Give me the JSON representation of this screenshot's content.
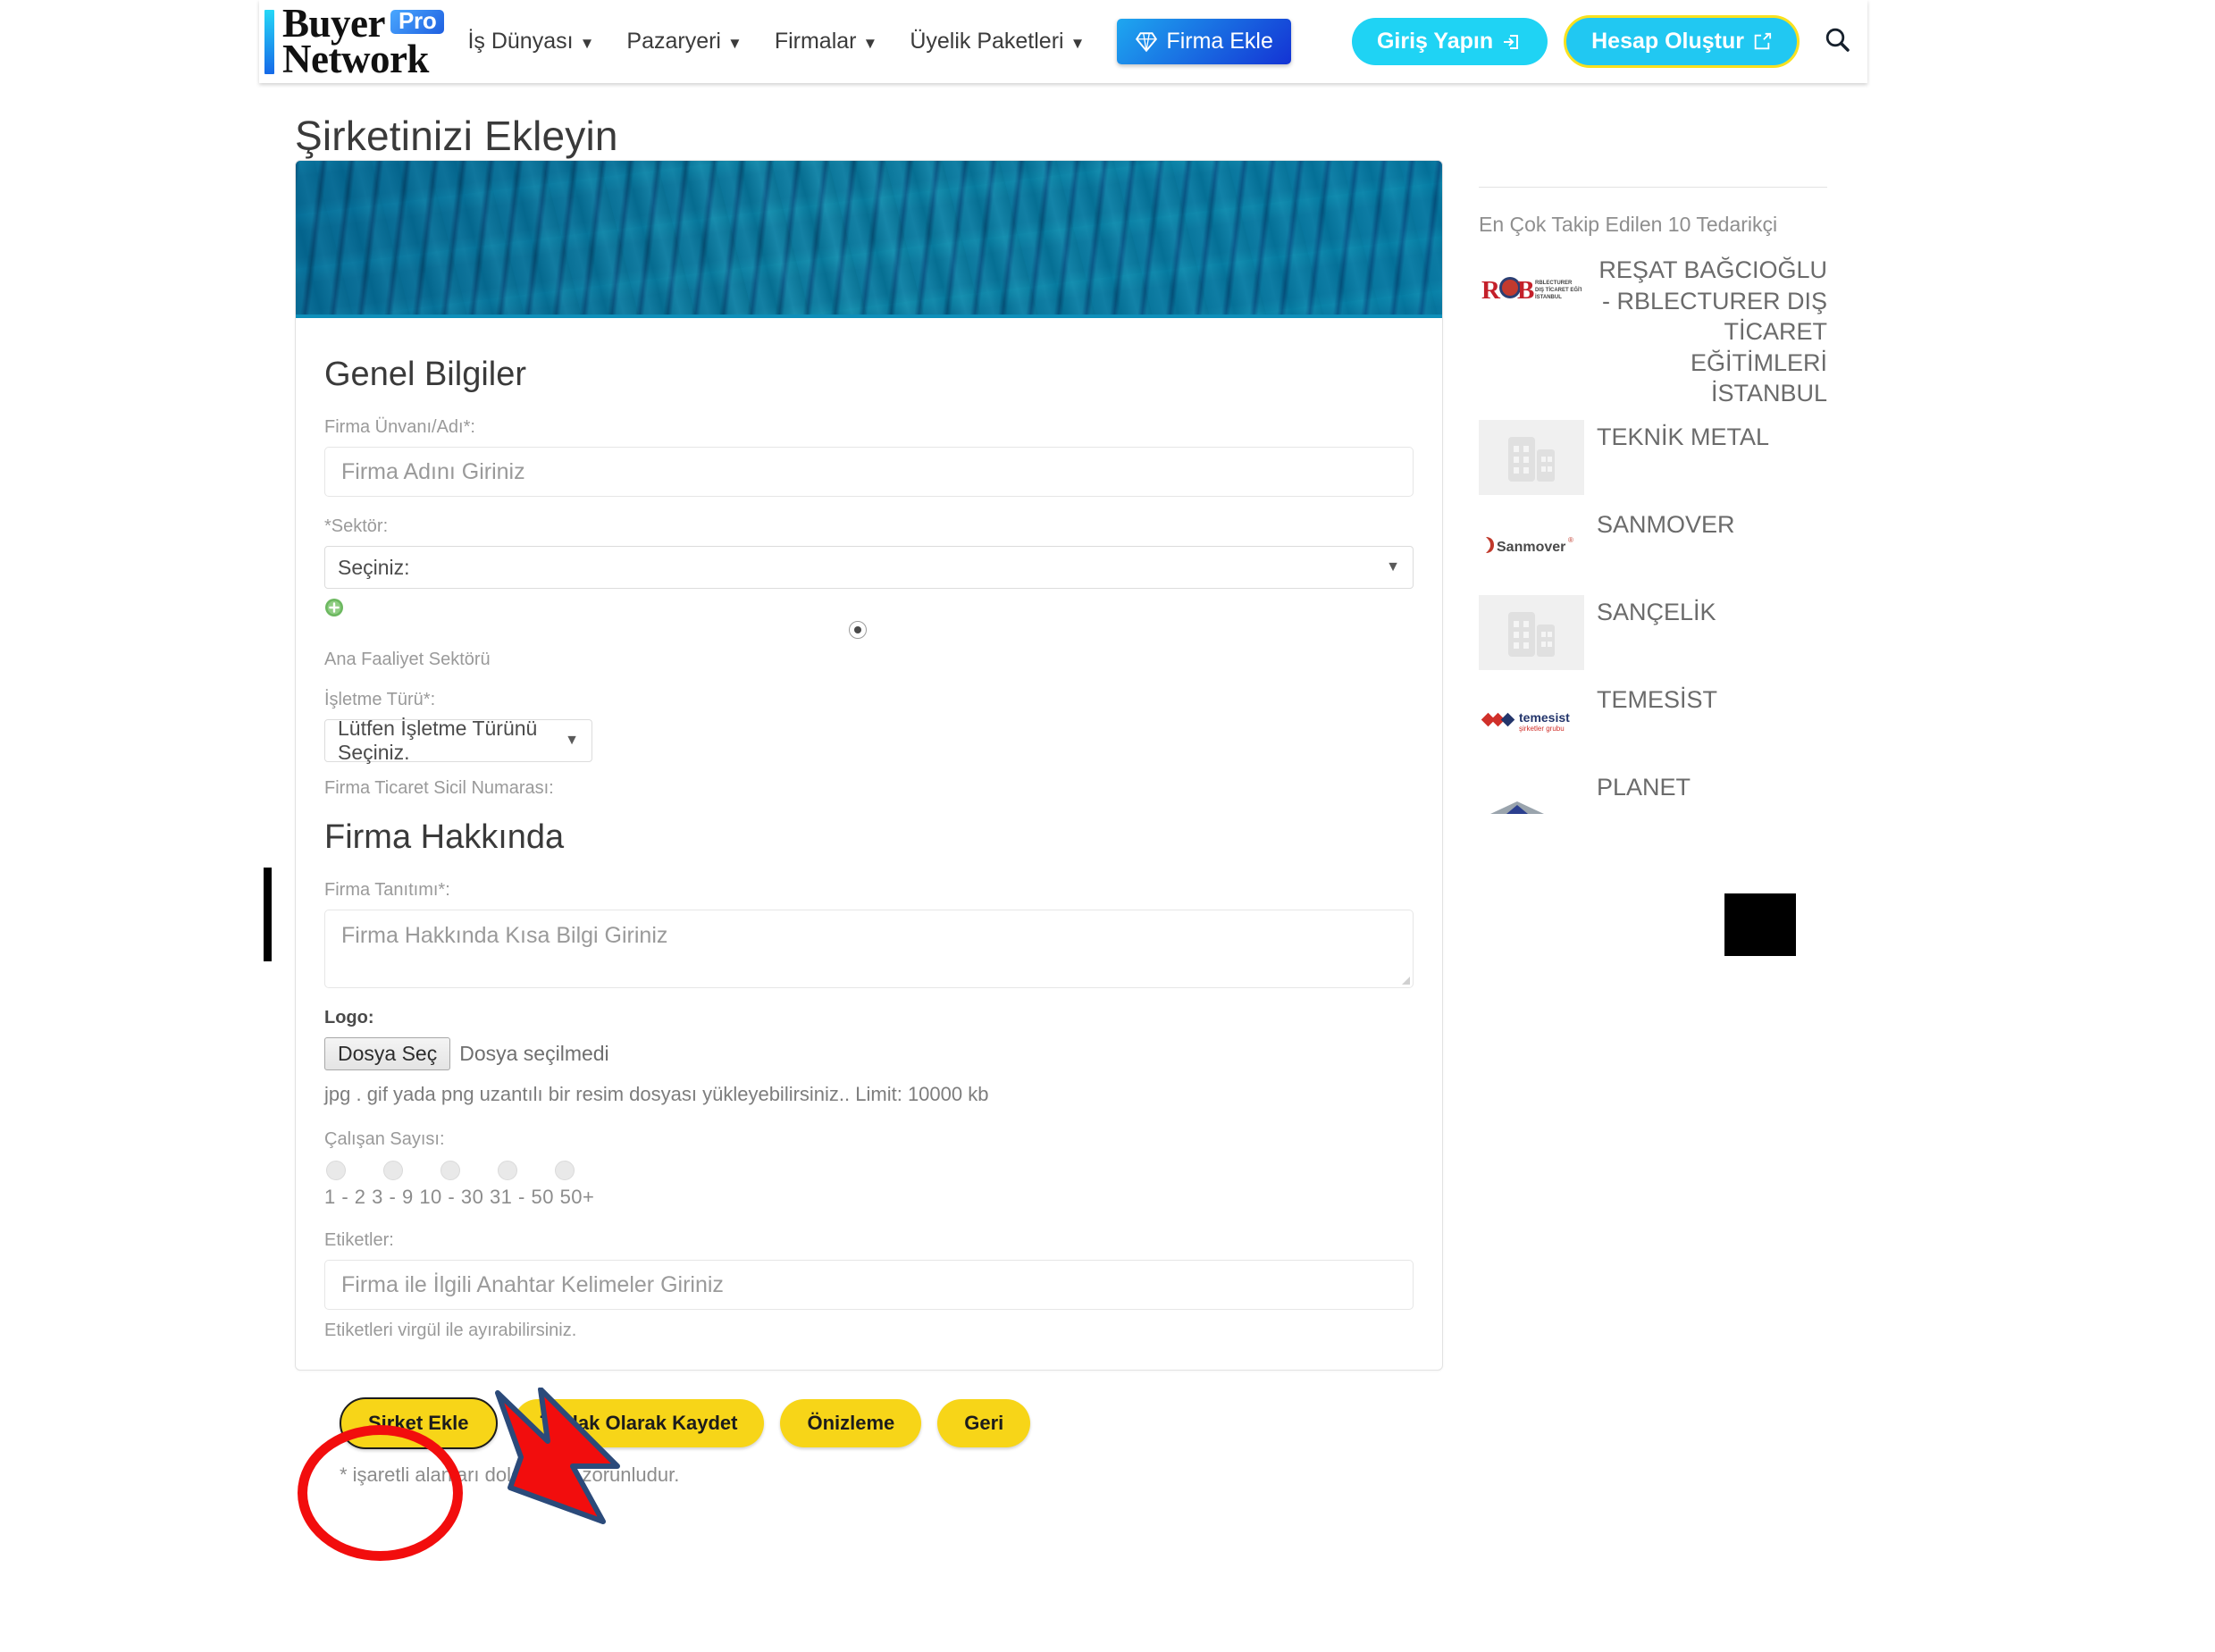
{
  "header": {
    "logo": {
      "line1": "Buyer",
      "line2": "Network",
      "badge": "Pro"
    },
    "nav": [
      {
        "label": "İş Dünyası",
        "caret": "chevron-down-icon"
      },
      {
        "label": "Pazaryeri",
        "caret": "chevron-down-icon"
      },
      {
        "label": "Firmalar",
        "caret": "chevron-down-icon"
      },
      {
        "label": "Üyelik Paketleri",
        "caret": "chevron-down-icon"
      }
    ],
    "add_company_button": "Firma Ekle",
    "login_button": "Giriş Yapın",
    "register_button": "Hesap Oluştur",
    "search_icon": "search-icon",
    "colors": {
      "add_company_start": "#1ea7f0",
      "add_company_end": "#1433d4",
      "login_bg": "#1fd3f4",
      "register_bg": "#21c8f2",
      "register_border": "#f9e11e"
    }
  },
  "page": {
    "title": "Şirketinizi Ekleyin"
  },
  "form": {
    "general": {
      "heading": "Genel Bilgiler",
      "company_name_label": "Firma Ünvanı/Adı*:",
      "company_name_placeholder": "Firma Adını Giriniz",
      "sector_label": "*Sektör:",
      "sector_value": "Seçiniz:",
      "add_sector_icon": "plus-circle-icon",
      "main_activity_label": "Ana Faaliyet Sektörü",
      "business_type_label": "İşletme Türü*:",
      "business_type_value": "Lütfen İşletme Türünü Seçiniz.",
      "trade_registry_label": "Firma Ticaret Sicil Numarası:"
    },
    "about": {
      "heading": "Firma Hakkında",
      "description_label": "Firma Tanıtımı*:",
      "description_placeholder": "Firma Hakkında Kısa Bilgi Giriniz",
      "logo_label": "Logo:",
      "file_button": "Dosya Seç",
      "file_status": "Dosya seçilmedi",
      "file_hint": "jpg . gif yada png uzantılı bir resim dosyası yükleyebilirsiniz.. Limit: 10000 kb",
      "employees_label": "Çalışan Sayısı:",
      "employee_options": [
        "1 - 2",
        "3 - 9",
        "10 - 30",
        "31 - 50",
        "50+"
      ],
      "tags_label": "Etiketler:",
      "tags_placeholder": "Firma ile İlgili Anahtar Kelimeler Giriniz",
      "tags_hint": "Etiketleri virgül ile ayırabilirsiniz."
    }
  },
  "actions": {
    "submit": "Şirket Ekle",
    "draft": "Taslak Olarak Kaydet",
    "preview": "Önizleme",
    "back": "Geri",
    "required_note": "* işaretli alanları doldurmak zorunludur.",
    "button_color": "#f7d518"
  },
  "sidebar": {
    "title": "En Çok Takip Edilen 10 Tedarikçi",
    "suppliers": [
      {
        "name": "REŞAT BAĞCIOĞLU - RBLECTURER DIŞ TİCARET EĞİTİMLERİ İSTANBUL",
        "logo": "rcb-logo"
      },
      {
        "name": "TEKNİK METAL",
        "logo": "building-placeholder-icon"
      },
      {
        "name": "SANMOVER",
        "logo": "sanmover-logo"
      },
      {
        "name": "SANÇELİK",
        "logo": "building-placeholder-icon"
      },
      {
        "name": "TEMESİST",
        "logo": "temesist-logo"
      },
      {
        "name": "PLANET",
        "logo": "planet-logo"
      }
    ]
  },
  "annotations": {
    "circle": "red-circle-highlight",
    "arrow": "red-arrow-pointer",
    "bar": "black-bar-marker",
    "box": "black-box-redaction"
  }
}
